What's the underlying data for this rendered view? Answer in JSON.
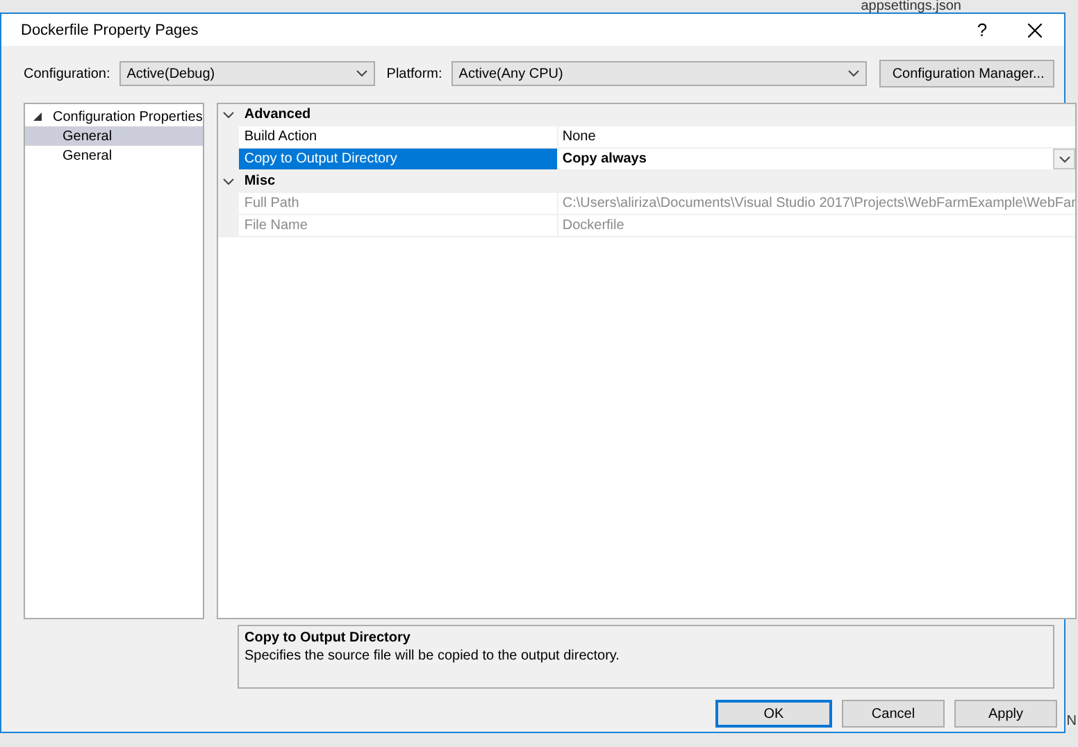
{
  "background": {
    "file_label": "appsettings.json",
    "edge_text": "N"
  },
  "window": {
    "title": "Dockerfile Property Pages",
    "help": "?"
  },
  "toolbar": {
    "configuration": {
      "label": "Configuration:",
      "value": "Active(Debug)"
    },
    "platform": {
      "label": "Platform:",
      "value": "Active(Any CPU)"
    },
    "manager_button": "Configuration Manager..."
  },
  "tree": [
    {
      "label": "Configuration Properties",
      "expanded": true,
      "selected": false,
      "children": [
        {
          "label": "General",
          "selected": true
        },
        {
          "label": "General",
          "selected": false
        }
      ]
    }
  ],
  "properties": [
    {
      "category": "Advanced",
      "expanded": true,
      "items": [
        {
          "name": "Build Action",
          "value": "None",
          "selected": false,
          "disabled": false
        },
        {
          "name": "Copy to Output Directory",
          "value": "Copy always",
          "selected": true,
          "disabled": false
        }
      ]
    },
    {
      "category": "Misc",
      "expanded": true,
      "items": [
        {
          "name": "Full Path",
          "value": "C:\\Users\\aliriza\\Documents\\Visual Studio 2017\\Projects\\WebFarmExample\\WebFar",
          "selected": false,
          "disabled": true
        },
        {
          "name": "File Name",
          "value": "Dockerfile",
          "selected": false,
          "disabled": true
        }
      ]
    }
  ],
  "description": {
    "title": "Copy to Output Directory",
    "text": "Specifies the source file will be copied to the output directory."
  },
  "buttons": [
    {
      "label": "OK",
      "default": true
    },
    {
      "label": "Cancel",
      "default": false
    },
    {
      "label": "Apply",
      "default": false
    }
  ]
}
